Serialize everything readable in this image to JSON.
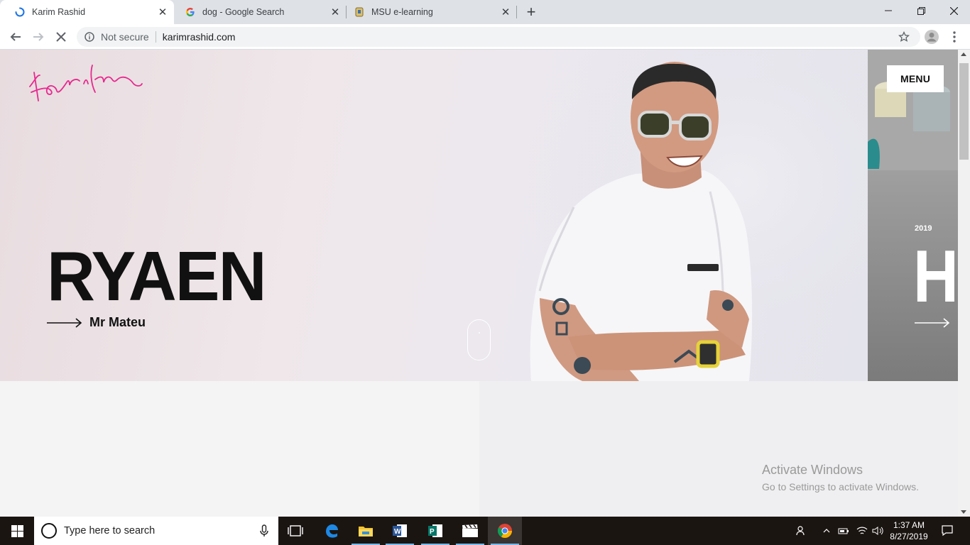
{
  "browser": {
    "tabs": [
      {
        "title": "Karim Rashid",
        "active": true,
        "favicon": "loading-spinner-icon"
      },
      {
        "title": "dog - Google Search",
        "active": false,
        "favicon": "google-g-icon"
      },
      {
        "title": "MSU e-learning",
        "active": false,
        "favicon": "msu-crest-icon"
      }
    ],
    "security_label": "Not secure",
    "url": "karimrashid.com"
  },
  "page": {
    "menu_label": "MENU",
    "slide_title": "RYAEN",
    "slide_subtitle": "Mr Mateu",
    "next_slide_year": "2019",
    "next_slide_title": "HE",
    "accent_color": "#e8288f"
  },
  "watermark": {
    "title": "Activate Windows",
    "subtitle": "Go to Settings to activate Windows."
  },
  "taskbar": {
    "search_placeholder": "Type here to search",
    "time": "1:37 AM",
    "date": "8/27/2019"
  }
}
